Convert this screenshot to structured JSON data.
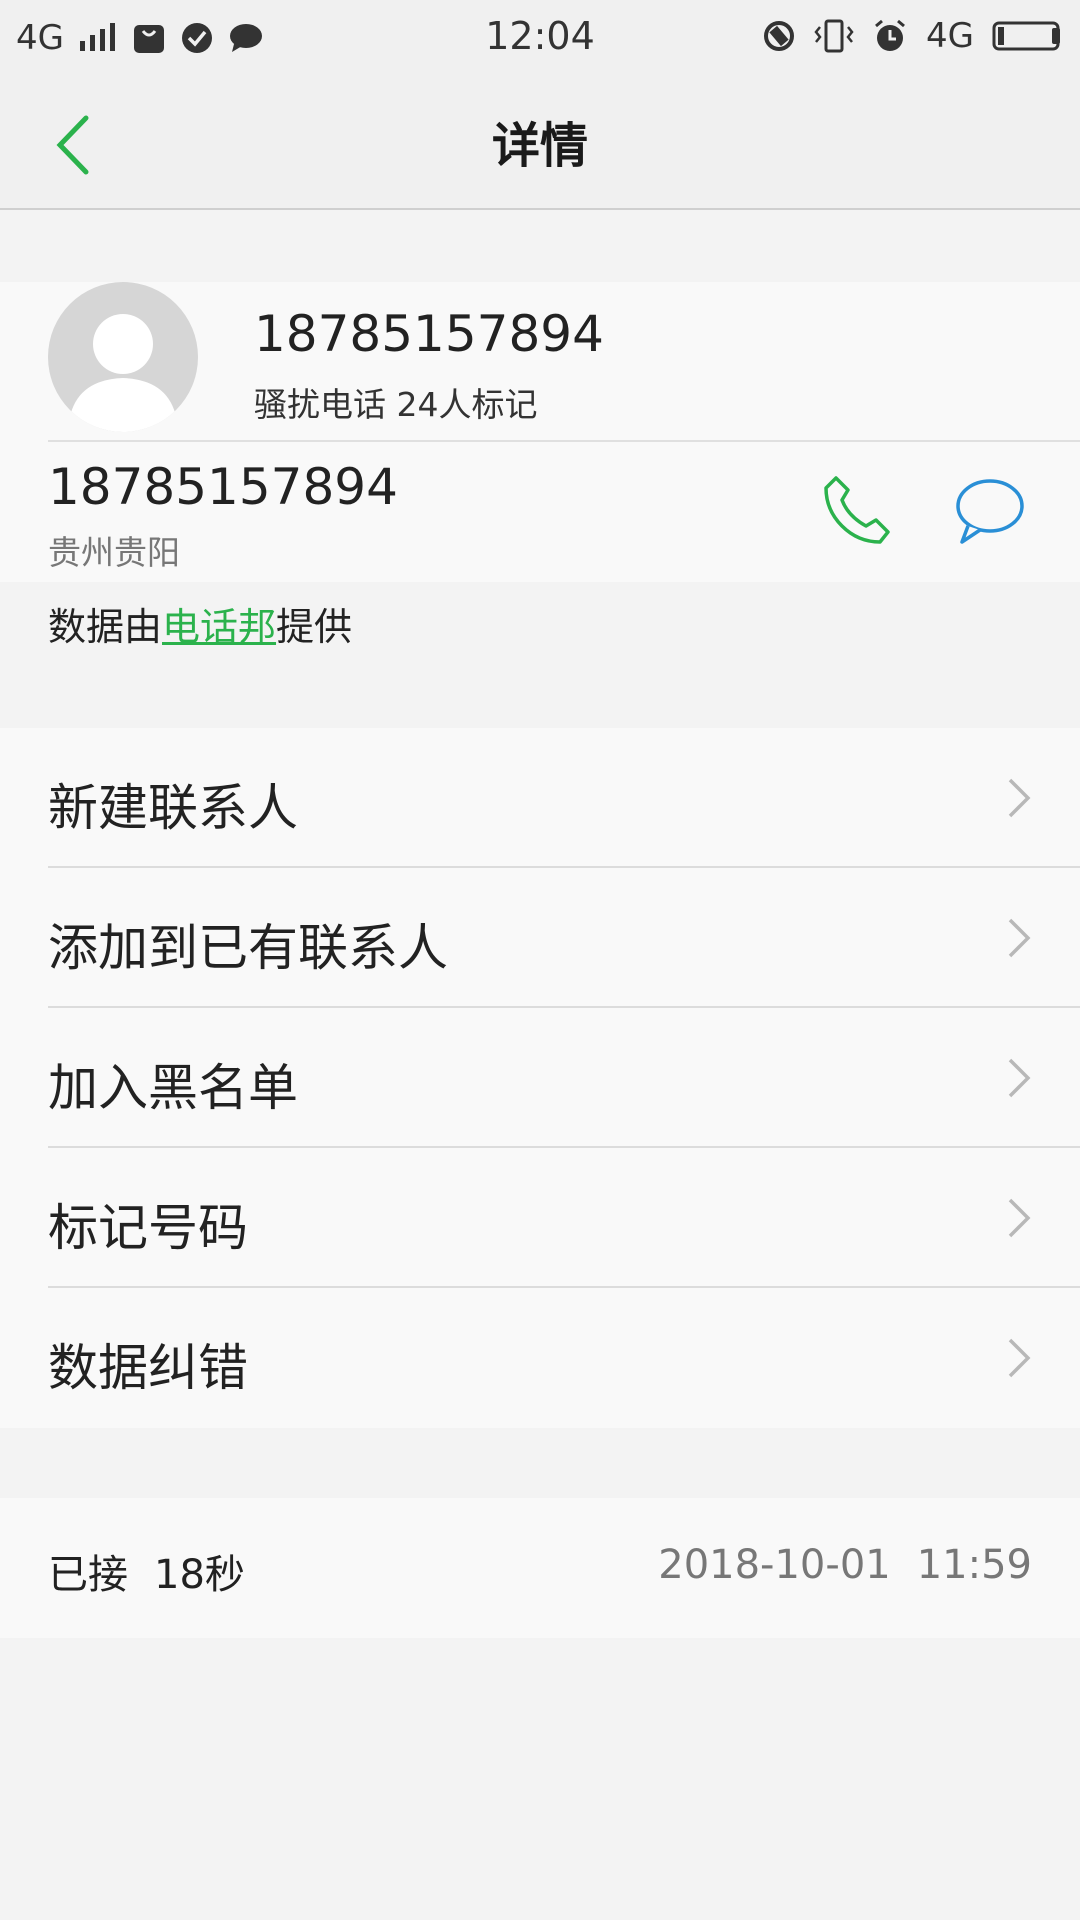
{
  "status_bar": {
    "network": "4G",
    "time": "12:04",
    "network_right": "4G",
    "icons_left": [
      "signal-icon",
      "bag-icon",
      "check-icon",
      "chat-bubble-icon"
    ],
    "icons_right": [
      "rotation-icon",
      "vibrate-icon",
      "alarm-icon",
      "battery-icon"
    ]
  },
  "header": {
    "title": "详情"
  },
  "contact": {
    "number": "18785157894",
    "tag_text": "骚扰电话 24人标记",
    "row_number": "18785157894",
    "location": "贵州贵阳"
  },
  "credit": {
    "prefix": "数据由",
    "link": "电话邦",
    "suffix": "提供"
  },
  "menu": {
    "items": [
      {
        "label": "新建联系人"
      },
      {
        "label": "添加到已有联系人"
      },
      {
        "label": "加入黑名单"
      },
      {
        "label": "标记号码"
      },
      {
        "label": "数据纠错"
      }
    ]
  },
  "call_log": {
    "status": "已接",
    "duration": "18秒",
    "date": "2018-10-01",
    "time": "11:59"
  },
  "colors": {
    "accent_green": "#2bb24c",
    "message_blue": "#2a8fd6"
  }
}
